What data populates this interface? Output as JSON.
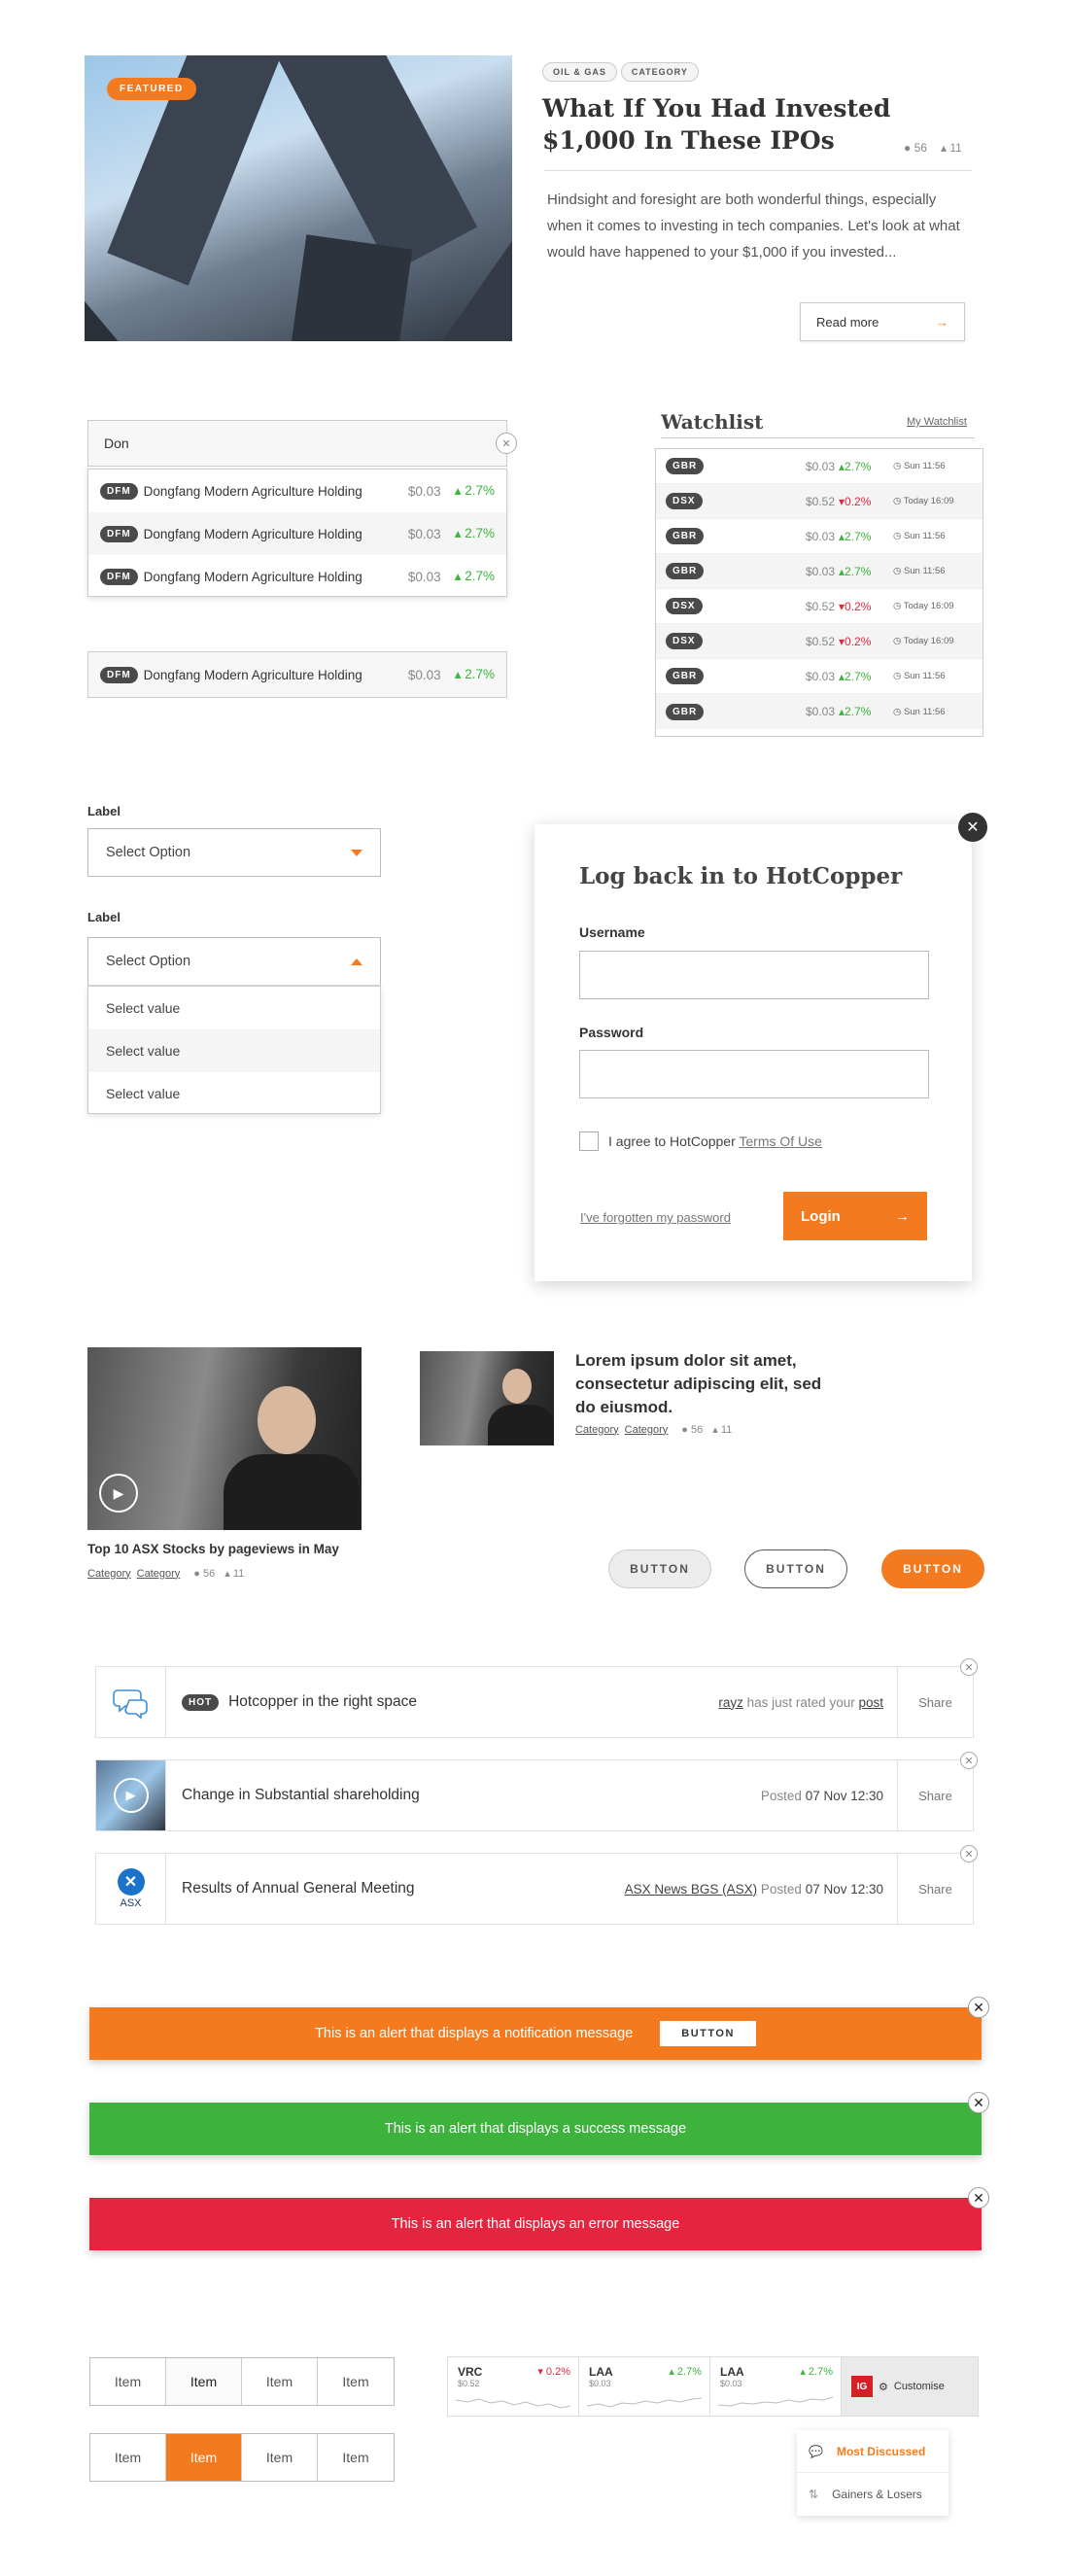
{
  "article": {
    "featured": "FEATURED",
    "tags": [
      "OIL & GAS",
      "CATEGORY"
    ],
    "title_line1": "What If You Had Invested",
    "title_line2": "$1,000 In These IPOs",
    "comments": "56",
    "likes": "11",
    "excerpt": "Hindsight and foresight are both wonderful things, especially when it comes to investing in tech companies. Let's look at what would have happened to your $1,000 if you invested...",
    "read_more": "Read more"
  },
  "search": {
    "value": "Don",
    "results": [
      {
        "code": "DFM",
        "name": "Dongfang Modern Agriculture Holding",
        "price": "$0.03",
        "change": "2.7%"
      },
      {
        "code": "DFM",
        "name": "Dongfang Modern Agriculture Holding",
        "price": "$0.03",
        "change": "2.7%"
      },
      {
        "code": "DFM",
        "name": "Dongfang Modern Agriculture Holding",
        "price": "$0.03",
        "change": "2.7%"
      }
    ],
    "single": {
      "code": "DFM",
      "name": "Dongfang Modern Agriculture Holding",
      "price": "$0.03",
      "change": "2.7%"
    }
  },
  "watchlist": {
    "title": "Watchlist",
    "link": "My Watchlist",
    "rows": [
      {
        "code": "GBR",
        "price": "$0.03",
        "change": "2.7%",
        "dir": "up",
        "time": "Sun 11:56"
      },
      {
        "code": "DSX",
        "price": "$0.52",
        "change": "0.2%",
        "dir": "down",
        "time": "Today 16:09"
      },
      {
        "code": "GBR",
        "price": "$0.03",
        "change": "2.7%",
        "dir": "up",
        "time": "Sun 11:56"
      },
      {
        "code": "GBR",
        "price": "$0.03",
        "change": "2.7%",
        "dir": "up",
        "time": "Sun 11:56"
      },
      {
        "code": "DSX",
        "price": "$0.52",
        "change": "0.2%",
        "dir": "down",
        "time": "Today 16:09"
      },
      {
        "code": "DSX",
        "price": "$0.52",
        "change": "0.2%",
        "dir": "down",
        "time": "Today 16:09"
      },
      {
        "code": "GBR",
        "price": "$0.03",
        "change": "2.7%",
        "dir": "up",
        "time": "Sun 11:56"
      },
      {
        "code": "GBR",
        "price": "$0.03",
        "change": "2.7%",
        "dir": "up",
        "time": "Sun 11:56"
      }
    ]
  },
  "form": {
    "label1": "Label",
    "select1": "Select Option",
    "label2": "Label",
    "select2": "Select Option",
    "options": [
      "Select value",
      "Select value",
      "Select value"
    ]
  },
  "login": {
    "title": "Log back in to HotCopper",
    "username_label": "Username",
    "password_label": "Password",
    "agree_text": "I agree to HotCopper",
    "terms": "Terms Of Use",
    "forgot": "I've forgotten my password",
    "button": "Login"
  },
  "media": {
    "video_caption": "Top 10 ASX Stocks by pageviews in May",
    "cat1": "Category",
    "cat2": "Category",
    "comments": "56",
    "likes": "11",
    "headline": "Lorem ipsum dolor sit amet, consectetur adipiscing elit, sed do eiusmod.",
    "h_cat1": "Category",
    "h_cat2": "Category",
    "h_comments": "56",
    "h_likes": "11"
  },
  "buttons": [
    "BUTTON",
    "BUTTON",
    "BUTTON"
  ],
  "notifications": [
    {
      "badge": "HOT",
      "text": "Hotcopper in the right space",
      "user": "rayz",
      "mid": "has just rated your",
      "obj": "post",
      "share": "Share"
    },
    {
      "text": "Change in Substantial shareholding",
      "posted": "Posted",
      "date": "07 Nov 12:30",
      "share": "Share"
    },
    {
      "text": "Results of Annual General Meeting",
      "source": "ASX News BGS (ASX)",
      "posted": "Posted",
      "date": "07 Nov 12:30",
      "share": "Share",
      "logo": "ASX"
    }
  ],
  "alerts": {
    "notify": "This is an alert that displays a notification message",
    "notify_button": "BUTTON",
    "success": "This is an alert that displays a success message",
    "error": "This is an alert that displays an error message"
  },
  "segments": {
    "row1": [
      "Item",
      "Item",
      "Item",
      "Item"
    ],
    "row2": [
      "Item",
      "Item",
      "Item",
      "Item"
    ]
  },
  "ticker": [
    {
      "code": "VRC",
      "price": "$0.52",
      "change": "0.2%",
      "dir": "down"
    },
    {
      "code": "LAA",
      "price": "$0.03",
      "change": "2.7%",
      "dir": "up"
    },
    {
      "code": "LAA",
      "price": "$0.03",
      "change": "2.7%",
      "dir": "up"
    }
  ],
  "customise": {
    "logo": "IG",
    "label": "Customise"
  },
  "menu": {
    "item1": "Most Discussed",
    "item2": "Gainers & Losers"
  },
  "colors": {
    "accent": "#f47a1f",
    "success": "#3db33e",
    "error": "#e3253f",
    "up": "#3bb43b",
    "down": "#e0283f"
  }
}
